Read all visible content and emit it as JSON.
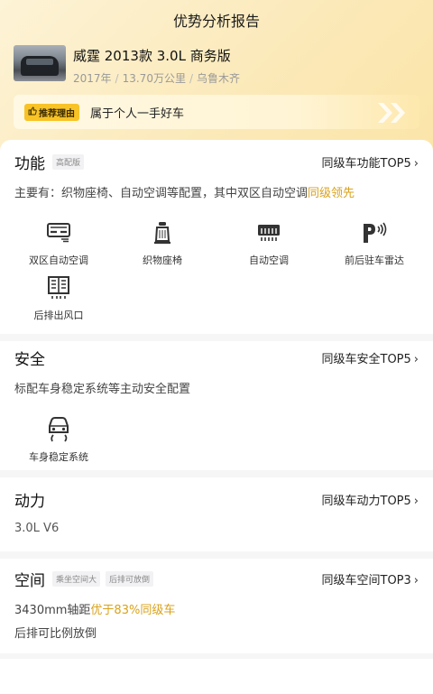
{
  "header": {
    "title": "优势分析报告"
  },
  "car": {
    "name": "威霆 2013款 3.0L 商务版",
    "year": "2017年",
    "mileage": "13.70万公里",
    "city": "乌鲁木齐",
    "sep": "/"
  },
  "reason": {
    "badge": "推荐理由",
    "text": "属于个人一手好车"
  },
  "sections": {
    "function": {
      "title": "功能",
      "tag": "高配版",
      "link": "同级车功能TOP5",
      "desc_prefix": "主要有：织物座椅、自动空调等配置，其中双区自动空调",
      "desc_highlight": "同级领先",
      "features": [
        {
          "label": "双区自动空调",
          "icon": "dual-zone-ac-icon"
        },
        {
          "label": "织物座椅",
          "icon": "fabric-seat-icon"
        },
        {
          "label": "自动空调",
          "icon": "auto-ac-icon"
        },
        {
          "label": "前后驻车雷达",
          "icon": "parking-radar-icon"
        },
        {
          "label": "后排出风口",
          "icon": "rear-vent-icon"
        }
      ]
    },
    "safety": {
      "title": "安全",
      "link": "同级车安全TOP5",
      "desc": "标配车身稳定系统等主动安全配置",
      "features": [
        {
          "label": "车身稳定系统",
          "icon": "stability-control-icon"
        }
      ]
    },
    "power": {
      "title": "动力",
      "link": "同级车动力TOP5",
      "desc": "3.0L V6"
    },
    "space": {
      "title": "空间",
      "tags": [
        "乘坐空间大",
        "后排可放倒"
      ],
      "link": "同级车空间TOP3",
      "desc_prefix": "3430mm轴距",
      "desc_highlight": "优于83%同级车",
      "desc2": "后排可比例放倒"
    }
  },
  "colors": {
    "accent": "#d9a21b",
    "badge": "#f7c326",
    "header_bg": "#fbe9b9"
  }
}
